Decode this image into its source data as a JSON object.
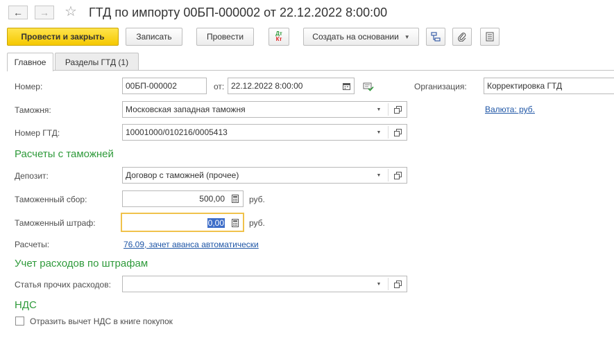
{
  "window": {
    "title": "ГТД по импорту 00БП-000002 от 22.12.2022 8:00:00"
  },
  "nav": {
    "back_icon": "arrow-left",
    "forward_icon": "arrow-right",
    "favorite_icon": "star"
  },
  "toolbar": {
    "post_close_label": "Провести и закрыть",
    "save_label": "Записать",
    "post_label": "Провести",
    "dtkt_top": "Дт",
    "dtkt_bottom": "Кт",
    "create_based_label": "Создать на основании"
  },
  "tabs": [
    {
      "label": "Главное",
      "active": true
    },
    {
      "label": "Разделы ГТД (1)",
      "active": false
    }
  ],
  "form": {
    "number_label": "Номер:",
    "number_value": "00БП-000002",
    "date_label": "от:",
    "date_value": "22.12.2022  8:00:00",
    "org_label": "Организация:",
    "org_value": "Корректировка ГТД",
    "currency_link": "Валюта: руб.",
    "customs_label": "Таможня:",
    "customs_value": "Московская западная таможня",
    "gtd_label": "Номер ГТД:",
    "gtd_value": "10001000/010216/0005413",
    "section_customs": "Расчеты с таможней",
    "deposit_label": "Депозит:",
    "deposit_value": "Договор с таможней (прочее)",
    "fee_label": "Таможенный сбор:",
    "fee_value": "500,00",
    "fee_unit": "руб.",
    "fine_label": "Таможенный штраф:",
    "fine_value": "0,00",
    "fine_unit": "руб.",
    "settlements_label": "Расчеты:",
    "settlements_link": "76.09, зачет аванса автоматически",
    "section_fines": "Учет расходов по штрафам",
    "expense_label": "Статья прочих расходов:",
    "expense_value": "",
    "section_vat": "НДС",
    "vat_checkbox_label": "Отразить вычет НДС в книге покупок",
    "vat_checked": false
  },
  "colors": {
    "accent_green": "#2e9a3a",
    "primary_yellow": "#f5c800",
    "link_blue": "#1f56a6",
    "focus_orange": "#f0c24b"
  }
}
